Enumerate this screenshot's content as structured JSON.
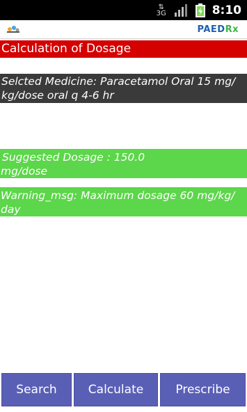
{
  "status_bar": {
    "network": "3G",
    "time": "8:10",
    "icons": [
      "network-arrows-icon",
      "signal-icon",
      "battery-charging-icon"
    ]
  },
  "app_header": {
    "brand_main": "PAED",
    "brand_accent": "Rx",
    "brand_color": "#1f5fb0",
    "accent_color": "#3bb34a"
  },
  "title": "Calculation of Dosage",
  "medicine": {
    "text": " Selcted Medicine: Paracetamol Oral 15 mg/ kg/dose oral q 4-6 hr"
  },
  "dosage": {
    "line1": "Suggested Dosage : 150.0",
    "line2": "mg/dose"
  },
  "warning": {
    "text": "Warning_msg: Maximum dosage 60 mg/kg/ day"
  },
  "buttons": {
    "search": "Search",
    "calculate": "Calculate",
    "prescribe": "Prescribe"
  },
  "colors": {
    "title_bg": "#d50000",
    "medicine_bg": "#3a3a3a",
    "green_bg": "#5cd64a",
    "button_bg": "#5a5fb6"
  }
}
